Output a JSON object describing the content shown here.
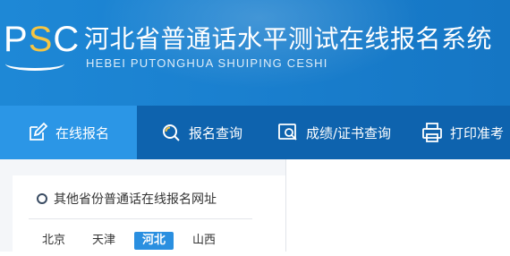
{
  "header": {
    "logo": "PSC",
    "title": "河北省普通话水平测试在线报名系统",
    "subtitle": "HEBEI PUTONGHUA SHUIPING CESHI"
  },
  "nav": {
    "items": [
      {
        "label": "在线报名",
        "icon": "edit-icon",
        "active": true
      },
      {
        "label": "报名查询",
        "icon": "search-icon",
        "active": false
      },
      {
        "label": "成绩/证书查询",
        "icon": "certificate-search-icon",
        "active": false
      },
      {
        "label": "打印准考",
        "icon": "printer-icon",
        "active": false
      }
    ]
  },
  "sidebar": {
    "title": "其他省份普通话在线报名网址",
    "provinces": [
      {
        "label": "北京",
        "active": false
      },
      {
        "label": "天津",
        "active": false
      },
      {
        "label": "河北",
        "active": true
      },
      {
        "label": "山西",
        "active": false
      }
    ]
  },
  "colors": {
    "header_bg": "#1a80cf",
    "nav_bg": "#0e63ae",
    "nav_active_bg": "#2b96e6",
    "logo_accent": "#f6c542",
    "province_active_bg": "#2a8fe0"
  }
}
